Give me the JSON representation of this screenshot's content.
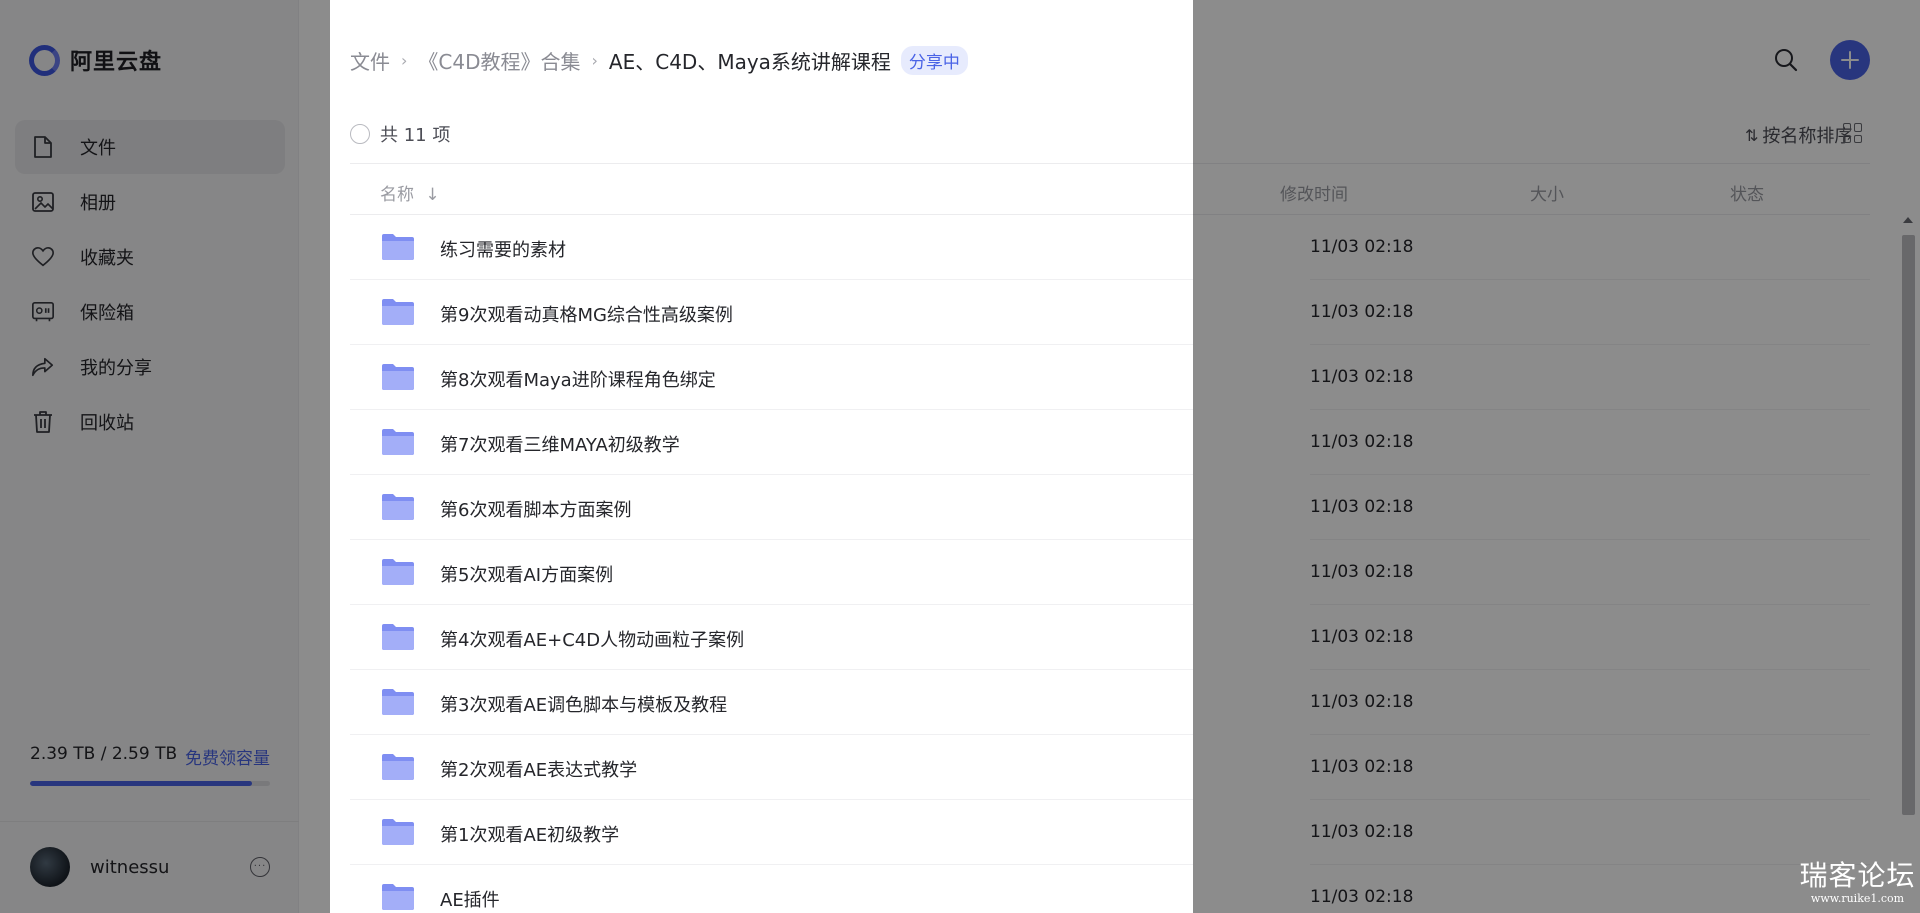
{
  "app": {
    "logo_text": "阿里云盘"
  },
  "sidebar": {
    "items": [
      {
        "label": "文件",
        "icon": "file-icon",
        "active": true
      },
      {
        "label": "相册",
        "icon": "album-icon",
        "active": false
      },
      {
        "label": "收藏夹",
        "icon": "heart-icon",
        "active": false
      },
      {
        "label": "保险箱",
        "icon": "safe-icon",
        "active": false
      },
      {
        "label": "我的分享",
        "icon": "share-icon",
        "active": false
      },
      {
        "label": "回收站",
        "icon": "trash-icon",
        "active": false
      }
    ],
    "storage": {
      "used_text": "2.39 TB / 2.59 TB",
      "link": "免费领容量",
      "fraction": 0.923
    },
    "user": {
      "name": "witnessu",
      "more": "···"
    }
  },
  "breadcrumb": {
    "items": [
      "文件",
      "《C4D教程》合集"
    ],
    "current": "AE、C4D、Maya系统讲解课程",
    "badge": "分享中",
    "separator": "›"
  },
  "toolbar": {
    "count": "共 11 项",
    "sort_label": "按名称排序",
    "sort_icon": "⇅"
  },
  "table": {
    "headers": {
      "name": "名称",
      "sort_arrow": "↓",
      "modified": "修改时间",
      "size": "大小",
      "status": "状态"
    },
    "rows": [
      {
        "name": "练习需要的素材",
        "time": "11/03 02:18"
      },
      {
        "name": "第9次观看动真格MG综合性高级案例",
        "time": "11/03 02:18"
      },
      {
        "name": "第8次观看Maya进阶课程角色绑定",
        "time": "11/03 02:18"
      },
      {
        "name": "第7次观看三维MAYA初级教学",
        "time": "11/03 02:18"
      },
      {
        "name": "第6次观看脚本方面案例",
        "time": "11/03 02:18"
      },
      {
        "name": "第5次观看AI方面案例",
        "time": "11/03 02:18"
      },
      {
        "name": "第4次观看AE+C4D人物动画粒子案例",
        "time": "11/03 02:18"
      },
      {
        "name": "第3次观看AE调色脚本与模板及教程",
        "time": "11/03 02:18"
      },
      {
        "name": "第2次观看AE表达式教学",
        "time": "11/03 02:18"
      },
      {
        "name": "第1次观看AE初级教学",
        "time": "11/03 02:18"
      },
      {
        "name": "AE插件",
        "time": "11/03 02:18"
      }
    ]
  },
  "watermark": {
    "title": "瑞客论坛",
    "url": "www.ruike1.com"
  },
  "colors": {
    "accent": "#4a63e6",
    "folder": "#8e9cf4",
    "badge_bg": "#e7ebfd"
  }
}
